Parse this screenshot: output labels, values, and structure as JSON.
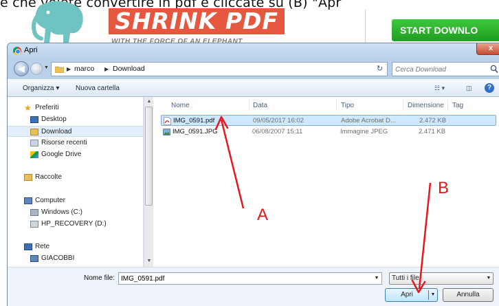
{
  "background_page": {
    "caption": "e che volete convertire in pdf e cliccate su (B) \"Apr",
    "logo_text": "SHRINK PDF",
    "logo_tagline": "WITH THE FORCE OF AN ELEPHANT",
    "start_button": "START DOWNLO"
  },
  "dialog": {
    "title": "Apri",
    "close_label": "x",
    "address": {
      "segments": [
        "marco",
        "Download"
      ]
    },
    "search_placeholder": "Cerca Download",
    "toolbar": {
      "organize_label": "Organizza ▾",
      "new_folder_label": "Nuova cartella"
    },
    "nav_pane": {
      "items": [
        {
          "label": "Preferiti"
        },
        {
          "label": "Desktop"
        },
        {
          "label": "Download"
        },
        {
          "label": "Risorse recenti"
        },
        {
          "label": "Google Drive"
        },
        {
          "label": "Raccolte"
        },
        {
          "label": "Computer"
        },
        {
          "label": "Windows  (C:)"
        },
        {
          "label": "HP_RECOVERY (D:)"
        },
        {
          "label": "Rete"
        },
        {
          "label": "GIACOBBI"
        }
      ]
    },
    "columns": [
      "Nome",
      "Data",
      "Tipo",
      "Dimensione",
      "Tag"
    ],
    "files": [
      {
        "name": "IMG_0591.pdf",
        "date": "09/05/2017 16:02",
        "type": "Adobe Acrobat D...",
        "size": "2.472 KB"
      },
      {
        "name": "IMG_0591.JPG",
        "date": "06/08/2007 15:11",
        "type": "Immagine JPEG",
        "size": "2.471 KB"
      }
    ],
    "bottom": {
      "filename_label": "Nome file:",
      "filename_value": "IMG_0591.pdf",
      "filetype_value": "Tutti i file",
      "open_label": "Apri",
      "cancel_label": "Annulla"
    }
  },
  "annotations": {
    "a_label": "A",
    "b_label": "B",
    "color": "#e8151c"
  },
  "colors": {
    "selection": "#cde8ff",
    "accent": "#3c7fb1",
    "logo": "#e5573f",
    "start_button": "#28b02a"
  }
}
